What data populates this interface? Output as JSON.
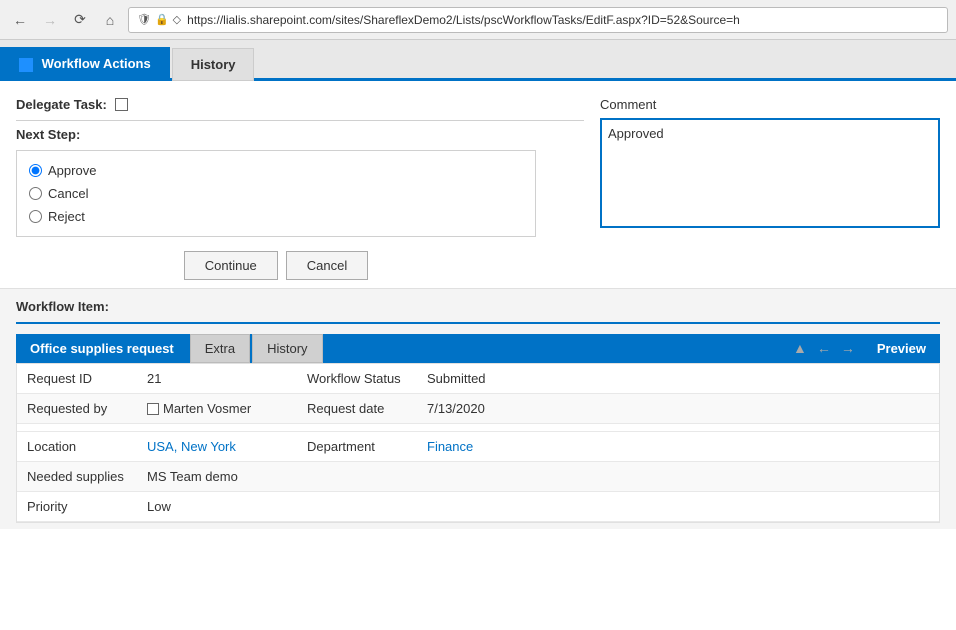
{
  "browser": {
    "url": "https://lialis.sharepoint.com/sites/ShareflexDemo2/Lists/pscWorkflowTasks/EditF.aspx?ID=52&Source=h"
  },
  "tabs": {
    "workflow_actions": "Workflow Actions",
    "history": "History"
  },
  "left": {
    "delegate_label": "Delegate Task:",
    "next_step_label": "Next Step:",
    "options": [
      "Approve",
      "Cancel",
      "Reject"
    ],
    "selected_option": "Approve",
    "continue_btn": "Continue",
    "cancel_btn": "Cancel"
  },
  "right": {
    "comment_label": "Comment",
    "comment_value": "Approved"
  },
  "workflow_item": {
    "label": "Workflow Item:",
    "inner_tabs": {
      "active": "Office supplies request",
      "extra": "Extra",
      "history": "History"
    },
    "preview_btn": "Preview",
    "rows": [
      {
        "label": "Request ID",
        "value": "21",
        "label2": "Workflow Status",
        "value2": "Submitted",
        "is_link2": false
      },
      {
        "label": "Requested by",
        "value": "Marten Vosmer",
        "label2": "Request date",
        "value2": "7/13/2020",
        "has_checkbox": true,
        "is_link2": false
      }
    ],
    "rows2": [
      {
        "label": "Location",
        "value": "USA, New York",
        "label2": "Department",
        "value2": "Finance",
        "is_link": true,
        "is_link2": true
      },
      {
        "label": "Needed supplies",
        "value": "MS Team demo",
        "label2": "",
        "value2": "",
        "is_link": false,
        "is_link2": false
      },
      {
        "label": "Priority",
        "value": "Low",
        "label2": "",
        "value2": "",
        "is_link": false,
        "is_link2": false
      }
    ]
  }
}
